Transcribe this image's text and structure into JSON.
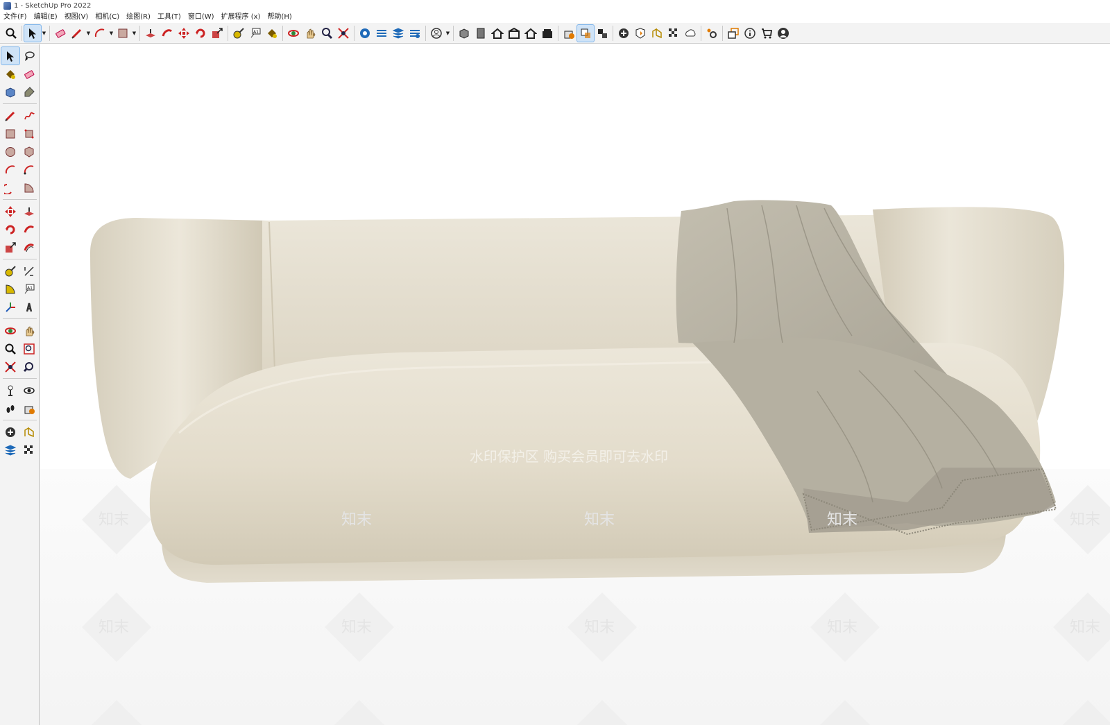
{
  "window": {
    "title": "1 - SketchUp Pro 2022"
  },
  "menu": [
    "文件(F)",
    "编辑(E)",
    "视图(V)",
    "相机(C)",
    "绘图(R)",
    "工具(T)",
    "窗口(W)",
    "扩展程序 (x)",
    "帮助(H)"
  ],
  "toolbar": [
    {
      "name": "zoom-icon"
    },
    {
      "sep": true
    },
    {
      "name": "select-icon",
      "active": true,
      "dropdown": true
    },
    {
      "sep": true
    },
    {
      "name": "eraser-icon"
    },
    {
      "name": "pencil-icon",
      "dropdown": true
    },
    {
      "name": "arc-icon",
      "dropdown": true
    },
    {
      "name": "rectangle-icon",
      "dropdown": true
    },
    {
      "sep": true
    },
    {
      "name": "push-pull-icon"
    },
    {
      "name": "follow-me-icon"
    },
    {
      "name": "move-icon"
    },
    {
      "name": "rotate-icon"
    },
    {
      "name": "scale-icon"
    },
    {
      "sep": true
    },
    {
      "name": "tape-measure-icon"
    },
    {
      "name": "text-icon"
    },
    {
      "name": "paint-bucket-icon"
    },
    {
      "sep": true
    },
    {
      "name": "orbit-icon"
    },
    {
      "name": "pan-icon"
    },
    {
      "name": "zoom-view-icon"
    },
    {
      "name": "zoom-extents-icon"
    },
    {
      "sep": true
    },
    {
      "name": "warehouse-icon"
    },
    {
      "name": "extension-warehouse-icon"
    },
    {
      "name": "layout-icon"
    },
    {
      "name": "extension-manager-icon"
    },
    {
      "sep": true
    },
    {
      "name": "account-icon",
      "dropdown": true
    },
    {
      "sep": true
    },
    {
      "name": "iso-view-icon"
    },
    {
      "name": "top-view-icon"
    },
    {
      "name": "front-view-icon"
    },
    {
      "name": "right-view-icon"
    },
    {
      "name": "back-view-icon"
    },
    {
      "name": "left-view-icon"
    },
    {
      "sep": true
    },
    {
      "name": "section-plane-icon"
    },
    {
      "name": "display-section-icon",
      "active": true
    },
    {
      "name": "section-cuts-icon"
    },
    {
      "sep": true
    },
    {
      "name": "add-location-icon"
    },
    {
      "name": "shadow-settings-icon"
    },
    {
      "name": "sandbox-icon"
    },
    {
      "name": "fog-icon"
    },
    {
      "name": "cloud-icon"
    },
    {
      "sep": true
    },
    {
      "name": "settings-icon"
    },
    {
      "sep": true
    },
    {
      "name": "window-icon"
    },
    {
      "name": "info-icon"
    },
    {
      "name": "cart-icon"
    },
    {
      "name": "user-icon"
    }
  ],
  "sidebar": [
    [
      {
        "name": "select-icon",
        "active": true
      },
      {
        "name": "lasso-icon"
      }
    ],
    [
      {
        "name": "paint-bucket-icon"
      },
      {
        "name": "eraser-icon"
      }
    ],
    [
      {
        "name": "make-component-icon"
      },
      {
        "name": "tag-icon"
      }
    ],
    [
      {
        "div": true
      }
    ],
    [
      {
        "name": "pencil-icon"
      },
      {
        "name": "freehand-icon"
      }
    ],
    [
      {
        "name": "rectangle-icon"
      },
      {
        "name": "rotated-rectangle-icon"
      }
    ],
    [
      {
        "name": "circle-icon"
      },
      {
        "name": "polygon-icon"
      }
    ],
    [
      {
        "name": "arc-icon"
      },
      {
        "name": "two-point-arc-icon"
      }
    ],
    [
      {
        "name": "three-point-arc-icon"
      },
      {
        "name": "pie-icon"
      }
    ],
    [
      {
        "div": true
      }
    ],
    [
      {
        "name": "move-icon"
      },
      {
        "name": "push-pull-icon"
      }
    ],
    [
      {
        "name": "rotate-icon"
      },
      {
        "name": "follow-me-icon"
      }
    ],
    [
      {
        "name": "scale-icon"
      },
      {
        "name": "offset-icon"
      }
    ],
    [
      {
        "div": true
      }
    ],
    [
      {
        "name": "tape-measure-icon"
      },
      {
        "name": "dimension-icon"
      }
    ],
    [
      {
        "name": "protractor-icon"
      },
      {
        "name": "text-icon"
      }
    ],
    [
      {
        "name": "axes-icon"
      },
      {
        "name": "3d-text-icon"
      }
    ],
    [
      {
        "div": true
      }
    ],
    [
      {
        "name": "orbit-icon"
      },
      {
        "name": "pan-icon"
      }
    ],
    [
      {
        "name": "zoom-icon"
      },
      {
        "name": "zoom-window-icon"
      }
    ],
    [
      {
        "name": "zoom-extents-icon"
      },
      {
        "name": "previous-view-icon"
      }
    ],
    [
      {
        "div": true
      }
    ],
    [
      {
        "name": "position-camera-icon"
      },
      {
        "name": "look-around-icon"
      }
    ],
    [
      {
        "name": "walk-icon"
      },
      {
        "name": "section-plane-icon"
      }
    ],
    [
      {
        "div": true
      }
    ],
    [
      {
        "name": "add-location-icon"
      },
      {
        "name": "sandbox-icon"
      }
    ],
    [
      {
        "name": "layers-icon"
      },
      {
        "name": "fog-icon"
      }
    ]
  ],
  "viewport": {
    "watermark_banner": "水印保护区  购买会员即可去水印",
    "watermark_tile": "知末"
  },
  "colors": {
    "sofa": "#e7e1d2",
    "sofa_shadow": "#cfc7b3",
    "throw": "#b9b4a5",
    "throw_dark": "#8f8a7c",
    "ui_bg": "#f3f3f3",
    "active": "#cfe3f7"
  }
}
